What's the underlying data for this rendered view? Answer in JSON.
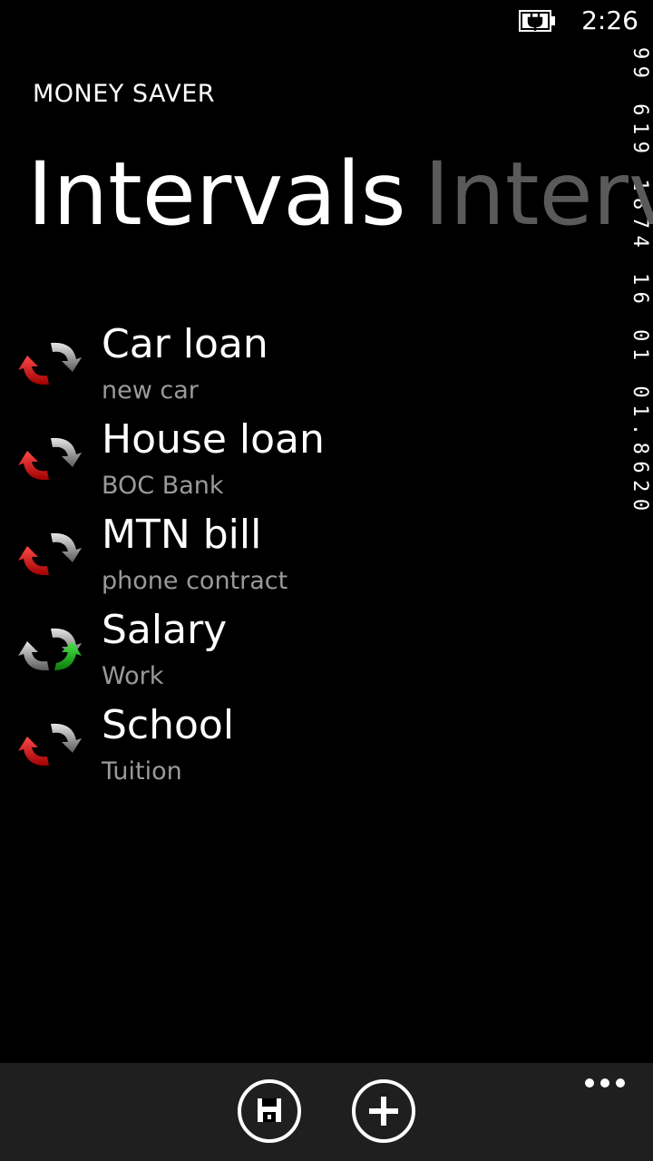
{
  "status_bar": {
    "time": "2:26",
    "battery_icon": "battery-charging-icon"
  },
  "side_counter": {
    "text": "99 619 1874 16 01 01.8620"
  },
  "app": {
    "title": "MONEY SAVER"
  },
  "pivot": {
    "active": "Intervals",
    "next": "Interv"
  },
  "intervals": {
    "items": [
      {
        "title": "Car loan",
        "subtitle": "new car",
        "icon": "refresh-red-icon",
        "status_color": "#e02020"
      },
      {
        "title": "House loan",
        "subtitle": "BOC Bank",
        "icon": "refresh-red-icon",
        "status_color": "#e02020"
      },
      {
        "title": "MTN bill",
        "subtitle": "phone contract",
        "icon": "refresh-red-icon",
        "status_color": "#e02020"
      },
      {
        "title": "Salary",
        "subtitle": "Work",
        "icon": "refresh-green-icon",
        "status_color": "#22b422"
      },
      {
        "title": "School",
        "subtitle": "Tuition",
        "icon": "refresh-red-icon",
        "status_color": "#e02020"
      }
    ]
  },
  "app_bar": {
    "buttons": [
      {
        "icon": "save-icon"
      },
      {
        "icon": "add-icon"
      }
    ],
    "more_icon": "more-dots-icon"
  },
  "colors": {
    "background": "#000000",
    "app_bar": "#1f1f1f",
    "subtitle": "#9a9a9a",
    "pivot_inactive": "#5a5a5a"
  }
}
